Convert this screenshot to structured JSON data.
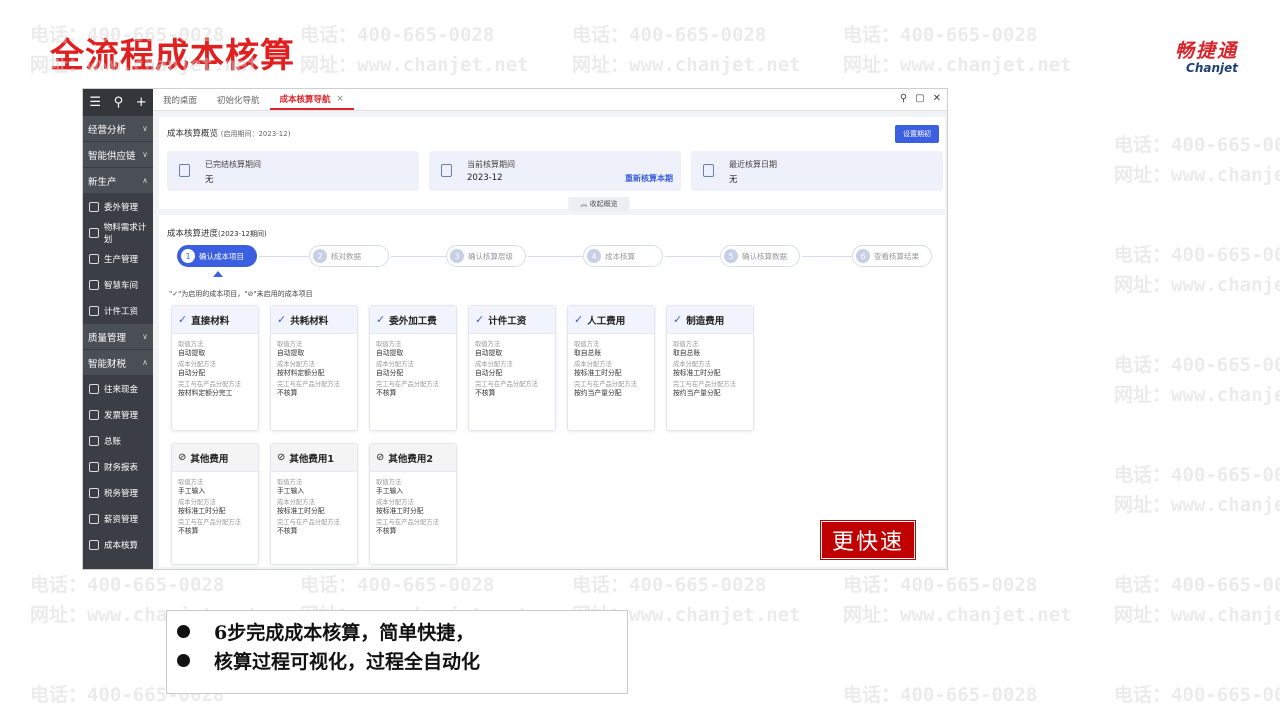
{
  "slide": {
    "title": "全流程成本核算"
  },
  "brand": {
    "cn": "畅捷通",
    "en": "Chanjet"
  },
  "watermark": {
    "phone": "电话：400-665-0028",
    "site": "网址：www.chanjet.net"
  },
  "sidebar": {
    "groups": [
      {
        "label": "经营分析"
      },
      {
        "label": "智能供应链"
      },
      {
        "label": "新生产"
      },
      {
        "label": "质量管理"
      },
      {
        "label": "智能财税"
      }
    ],
    "production_items": [
      "委外管理",
      "物料需求计划",
      "生产管理",
      "智慧车间",
      "计件工资"
    ],
    "finance_items": [
      "往来现金",
      "发票管理",
      "总账",
      "财务报表",
      "税务管理",
      "薪资管理",
      "成本核算"
    ]
  },
  "tabs": [
    {
      "label": "我的桌面"
    },
    {
      "label": "初始化导航"
    },
    {
      "label": "成本核算导航",
      "close": "×"
    }
  ],
  "overview": {
    "title": "成本核算概览",
    "period_note": "(启用期间：2023-12)",
    "settings_button": "设置期初",
    "cards": [
      {
        "label": "已完结核算期间",
        "value": "无"
      },
      {
        "label": "当前核算期间",
        "value": "2023-12",
        "link": "重新核算本期"
      },
      {
        "label": "最近核算日期",
        "value": "无"
      }
    ],
    "collapse_label": "收起概览"
  },
  "progress": {
    "title": "成本核算进度",
    "period_note": "(2023-12期间)",
    "steps": [
      {
        "num": "1",
        "label": "确认成本项目"
      },
      {
        "num": "2",
        "label": "核对数据"
      },
      {
        "num": "3",
        "label": "确认核算层级"
      },
      {
        "num": "4",
        "label": "成本核算"
      },
      {
        "num": "5",
        "label": "确认核算数据"
      },
      {
        "num": "6",
        "label": "查看核算结果"
      }
    ],
    "legend": "\"✓\"为启用的成本项目，\"⊘\"未启用的成本项目"
  },
  "field_labels": {
    "fetch": "取值方法",
    "alloc": "成本分配方法",
    "wip": "完工与在产品分配方法"
  },
  "cost_items": [
    {
      "name": "直接材料",
      "enabled": true,
      "fetch": "自动提取",
      "alloc": "自动分配",
      "wip": "按材料定额分完工"
    },
    {
      "name": "共耗材料",
      "enabled": true,
      "fetch": "自动提取",
      "alloc": "按材料定额分配",
      "wip": "不核算"
    },
    {
      "name": "委外加工费",
      "enabled": true,
      "fetch": "自动提取",
      "alloc": "自动分配",
      "wip": "不核算"
    },
    {
      "name": "计件工资",
      "enabled": true,
      "fetch": "自动提取",
      "alloc": "自动分配",
      "wip": "不核算"
    },
    {
      "name": "人工费用",
      "enabled": true,
      "fetch": "取自总账",
      "alloc": "按标准工时分配",
      "wip": "按约当产量分配"
    },
    {
      "name": "制造费用",
      "enabled": true,
      "fetch": "取自总账",
      "alloc": "按标准工时分配",
      "wip": "按约当产量分配"
    },
    {
      "name": "其他费用",
      "enabled": false,
      "fetch": "手工输入",
      "alloc": "按标准工时分配",
      "wip": "不核算"
    },
    {
      "name": "其他费用1",
      "enabled": false,
      "fetch": "手工输入",
      "alloc": "按标准工时分配",
      "wip": "不核算"
    },
    {
      "name": "其他费用2",
      "enabled": false,
      "fetch": "手工输入",
      "alloc": "按标准工时分配",
      "wip": "不核算"
    }
  ],
  "badge": {
    "label": "更快速"
  },
  "bullets": [
    "6步完成成本核算，简单快捷，",
    "核算过程可视化，过程全自动化"
  ],
  "colors": {
    "accent": "#3b5fe0",
    "title_red": "#e02020",
    "badge_red": "#c00000",
    "sidebar": "#3b3f45"
  }
}
